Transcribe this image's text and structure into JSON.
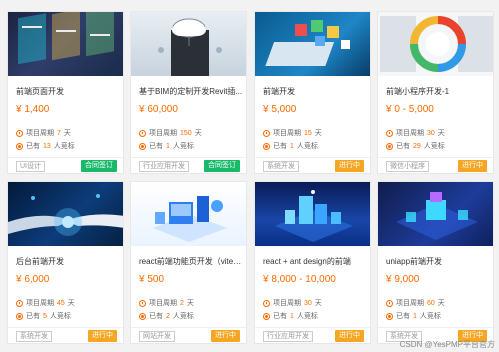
{
  "cards": [
    {
      "title": "前端页面开发",
      "price": "¥ 1,400",
      "period_label": "项目周期",
      "period_value": "7",
      "period_unit": "天",
      "bid_prefix": "已有",
      "bid_value": "13",
      "bid_suffix": "人竞标",
      "tag": "UI设计",
      "status": "合同签订",
      "status_color": "#19b96a"
    },
    {
      "title": "基于BIM的定制开发Revit插...",
      "price": "¥ 60,000",
      "period_label": "项目周期",
      "period_value": "150",
      "period_unit": "天",
      "bid_prefix": "已有",
      "bid_value": "1",
      "bid_suffix": "人竞标",
      "tag": "行业应用开发",
      "status": "合同签订",
      "status_color": "#19b96a"
    },
    {
      "title": "前端开发",
      "price": "¥ 5,000",
      "period_label": "项目周期",
      "period_value": "15",
      "period_unit": "天",
      "bid_prefix": "已有",
      "bid_value": "1",
      "bid_suffix": "人竞标",
      "tag": "系统开发",
      "status": "进行中",
      "status_color": "#f5a623"
    },
    {
      "title": "前端小程序开发-1",
      "price": "¥ 0 - 5,000",
      "period_label": "项目周期",
      "period_value": "30",
      "period_unit": "天",
      "bid_prefix": "已有",
      "bid_value": "29",
      "bid_suffix": "人竞标",
      "tag": "微信小程序",
      "status": "进行中",
      "status_color": "#f5a623"
    },
    {
      "title": "后台前端开发",
      "price": "¥ 6,000",
      "period_label": "项目周期",
      "period_value": "45",
      "period_unit": "天",
      "bid_prefix": "已有",
      "bid_value": "5",
      "bid_suffix": "人竞标",
      "tag": "系统开发",
      "status": "进行中",
      "status_color": "#f5a623"
    },
    {
      "title": "react前端功能页开发（vite架...",
      "price": "¥ 500",
      "period_label": "项目周期",
      "period_value": "2",
      "period_unit": "天",
      "bid_prefix": "已有",
      "bid_value": "2",
      "bid_suffix": "人竞标",
      "tag": "网站开发",
      "status": "进行中",
      "status_color": "#f5a623"
    },
    {
      "title": "react + ant design的前端",
      "price": "¥ 8,000 - 10,000",
      "period_label": "项目周期",
      "period_value": "30",
      "period_unit": "天",
      "bid_prefix": "已有",
      "bid_value": "1",
      "bid_suffix": "人竞标",
      "tag": "行业应用开发",
      "status": "进行中",
      "status_color": "#f5a623"
    },
    {
      "title": "uniapp前端开发",
      "price": "¥ 9,000",
      "period_label": "项目周期",
      "period_value": "60",
      "period_unit": "天",
      "bid_prefix": "已有",
      "bid_value": "1",
      "bid_suffix": "人竞标",
      "tag": "系统开发",
      "status": "进行中",
      "status_color": "#f5a623"
    }
  ],
  "watermark": "CSDN @YesPMP平台官方",
  "colors": {
    "accent": "#ff6a00",
    "signed": "#19b96a",
    "in_progress": "#f5a623"
  }
}
